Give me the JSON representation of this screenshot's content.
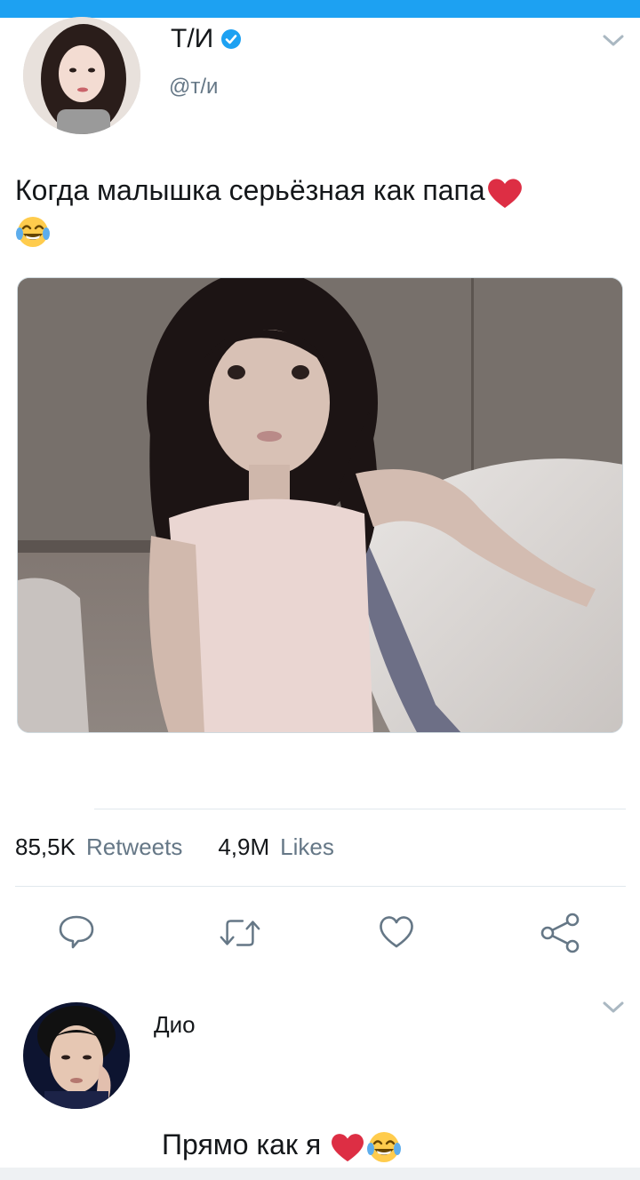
{
  "tweet": {
    "author_name": "Т/И",
    "verified": true,
    "handle": "@т/и",
    "text": "Когда малышка серьёзная как папа",
    "image_alt": "photo of a little girl in a pink top sitting on a bed",
    "retweets_count": "85,5K",
    "retweets_label": "Retweets",
    "likes_count": "4,9M",
    "likes_label": "Likes"
  },
  "actions": {
    "reply": "reply-icon",
    "retweet": "retweet-icon",
    "like": "heart-icon",
    "share": "share-icon"
  },
  "reply": {
    "author_name": "Дио",
    "text": "Прямо как я"
  },
  "colors": {
    "accent": "#1da1f2",
    "secondary_text": "#657786",
    "heart": "#e0245e"
  }
}
